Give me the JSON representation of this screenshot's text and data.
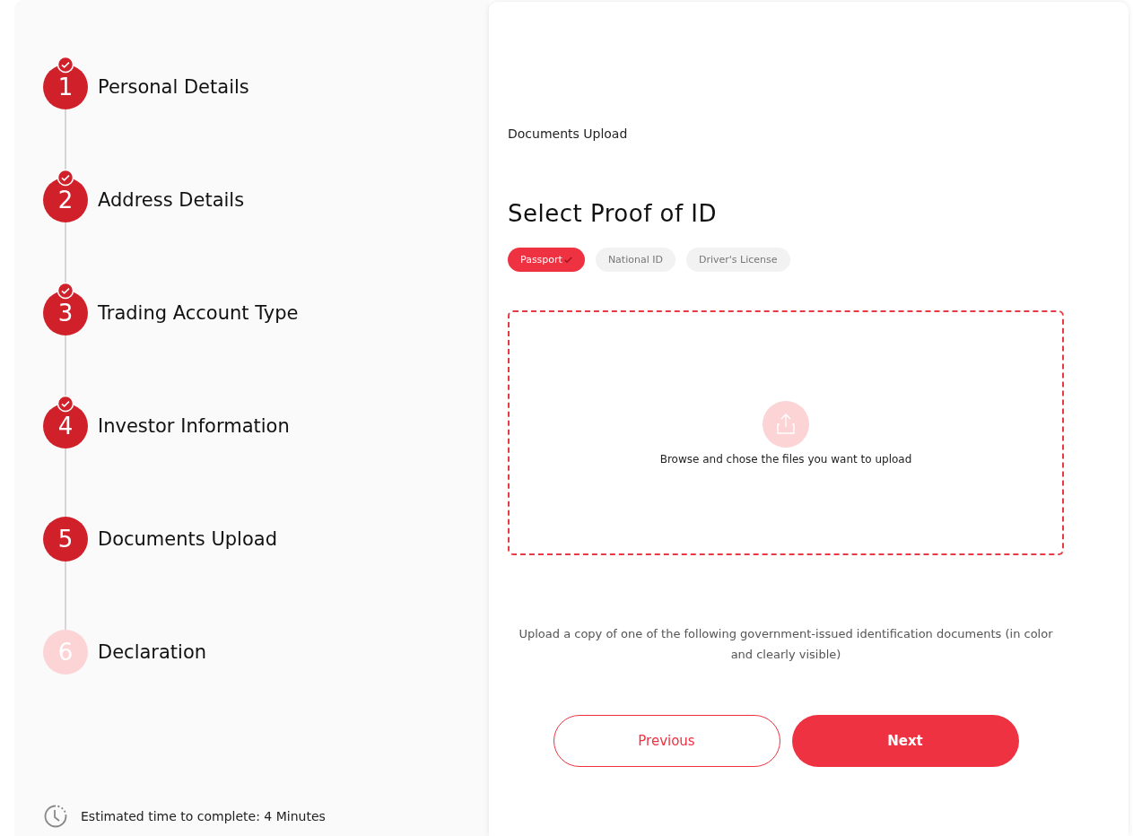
{
  "steps": [
    {
      "number": "1",
      "label": "Personal Details",
      "completed": true
    },
    {
      "number": "2",
      "label": "Address Details",
      "completed": true
    },
    {
      "number": "3",
      "label": "Trading Account Type",
      "completed": true
    },
    {
      "number": "4",
      "label": "Investor Information",
      "completed": true
    },
    {
      "number": "5",
      "label": "Documents Upload",
      "completed": false
    },
    {
      "number": "6",
      "label": "Declaration",
      "completed": false
    }
  ],
  "estimate": "Estimated time to complete: 4 Minutes",
  "section": "Documents Upload",
  "title": "Select Proof of ID",
  "id_options": [
    {
      "label": "Passport",
      "selected": true
    },
    {
      "label": "National ID",
      "selected": false
    },
    {
      "label": "Driver's License",
      "selected": false
    }
  ],
  "dropzone": {
    "text": "Browse and chose the files you want to upload"
  },
  "note": "Upload a copy of one of the following government-issued identification documents (in color and clearly visible)",
  "buttons": [
    {
      "label": "Previous",
      "kind": "secondary"
    },
    {
      "label": "Next",
      "kind": "primary"
    }
  ]
}
